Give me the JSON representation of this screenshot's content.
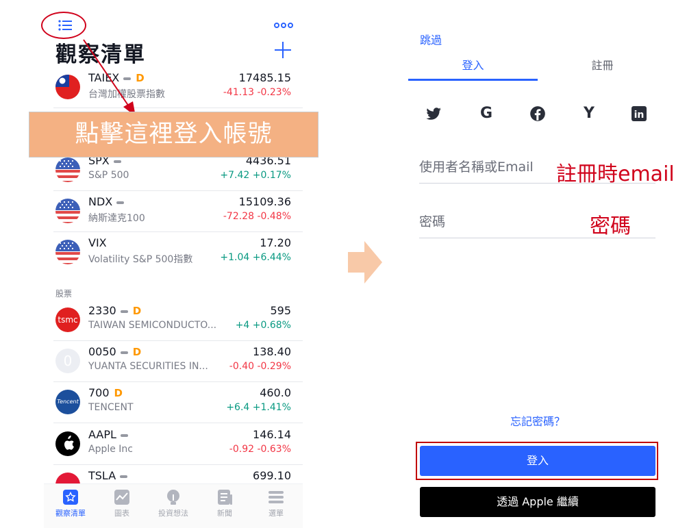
{
  "left": {
    "title": "觀察清單",
    "rows": [
      {
        "symbol": "TAIEX",
        "dash": true,
        "d": "D",
        "name": "台灣加權股票指數",
        "price": "17485.15",
        "change": "-41.13",
        "pct": "-0.23%",
        "dir": "neg",
        "flag": "tw"
      },
      {
        "symbol": "SPX",
        "dash": true,
        "d": "",
        "name": "S&P 500",
        "price": "4436.51",
        "change": "+7.42",
        "pct": "+0.17%",
        "dir": "pos",
        "flag": "us"
      },
      {
        "symbol": "NDX",
        "dash": true,
        "d": "",
        "name": "納斯達克100",
        "price": "15109.36",
        "change": "-72.28",
        "pct": "-0.48%",
        "dir": "neg",
        "flag": "us"
      },
      {
        "symbol": "VIX",
        "dash": false,
        "d": "",
        "name": "Volatility S&P 500指數",
        "price": "17.20",
        "change": "+1.04",
        "pct": "+6.44%",
        "dir": "pos",
        "flag": "us"
      },
      {
        "symbol": "2330",
        "dash": true,
        "d": "D",
        "name": "TAIWAN SEMICONDUCTO...",
        "price": "595",
        "change": "+4",
        "pct": "+0.68%",
        "dir": "pos",
        "flag": "tsmc"
      },
      {
        "symbol": "0050",
        "dash": true,
        "d": "D",
        "name": "YUANTA SECURITIES IN...",
        "price": "138.40",
        "change": "-0.40",
        "pct": "-0.29%",
        "dir": "neg",
        "flag": "zero"
      },
      {
        "symbol": "700",
        "dash": false,
        "d": "D",
        "name": "TENCENT",
        "price": "460.0",
        "change": "+6.4",
        "pct": "+1.41%",
        "dir": "pos",
        "flag": "tencent"
      },
      {
        "symbol": "AAPL",
        "dash": true,
        "d": "",
        "name": "Apple Inc",
        "price": "146.14",
        "change": "-0.92",
        "pct": "-0.63%",
        "dir": "neg",
        "flag": "apple"
      },
      {
        "symbol": "TSLA",
        "dash": true,
        "d": "",
        "name": "",
        "price": "699.10",
        "change": "",
        "pct": "",
        "dir": "neg",
        "flag": "tsla"
      }
    ],
    "section_label": "股票",
    "tabs": [
      {
        "label": "觀察清單",
        "icon": "star-icon",
        "active": true
      },
      {
        "label": "圖表",
        "icon": "chart-icon",
        "active": false
      },
      {
        "label": "投資想法",
        "icon": "bulb-icon",
        "active": false
      },
      {
        "label": "新聞",
        "icon": "news-icon",
        "active": false
      },
      {
        "label": "選單",
        "icon": "menu-icon",
        "active": false
      }
    ],
    "logo_texts": {
      "tsmc": "tsmc",
      "zero": "0",
      "tencent": "Tencent"
    }
  },
  "annotation": {
    "banner": "點擊這裡登入帳號",
    "email_note": "註冊時email",
    "pwd_note": "密碼"
  },
  "right": {
    "skip": "跳過",
    "tab_login": "登入",
    "tab_register": "註冊",
    "socials": [
      "twitter-icon",
      "google-icon",
      "facebook-icon",
      "yahoo-icon",
      "linkedin-icon"
    ],
    "social_glyphs": {
      "google": "G",
      "yahoo": "Y",
      "linkedin": "in"
    },
    "username_placeholder": "使用者名稱或Email",
    "password_placeholder": "密碼",
    "forgot": "忘記密碼？",
    "login_button": "登入",
    "apple_button": "透過 Apple 繼續",
    "apple_glyph": ""
  },
  "colors": {
    "accent": "#2962ff",
    "negative": "#f23645",
    "positive": "#089981",
    "annotation_red": "#d0021b",
    "banner_bg": "#f4b183"
  }
}
